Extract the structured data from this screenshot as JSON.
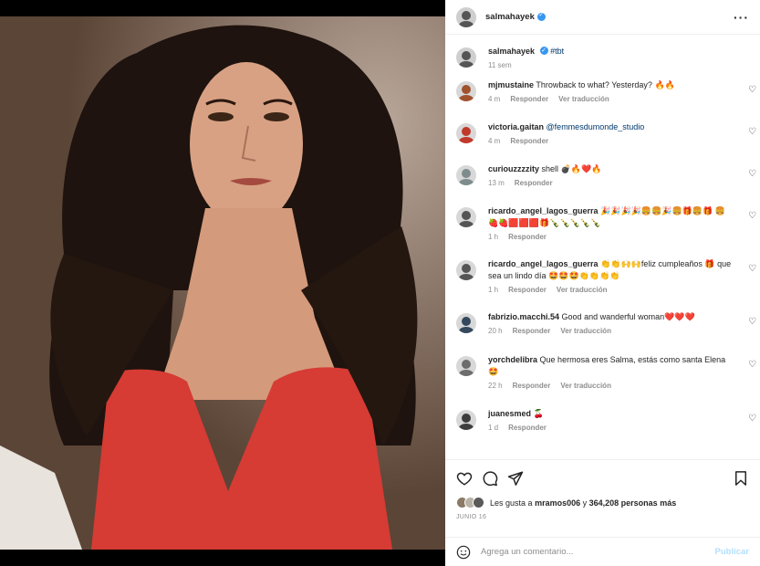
{
  "post": {
    "author": "salmahayek",
    "more_icon": "more-dots-icon",
    "image_description_label": ""
  },
  "caption": {
    "author": "salmahayek",
    "text": "#tbt",
    "time": "11 sem"
  },
  "labels": {
    "reply": "Responder",
    "translate": "Ver traducción"
  },
  "comments": [
    {
      "user": "mjmustaine",
      "text": "Throwback to what? Yesterday? 🔥🔥",
      "time": "4 m",
      "translate": true,
      "color": "#a0522d"
    },
    {
      "user": "victoria.gaitan",
      "text": "@femmesdumonde_studio",
      "mention": true,
      "time": "4 m",
      "translate": false,
      "color": "#c0392b"
    },
    {
      "user": "curiouzzzzity",
      "text": "shell 💣🔥❤️🔥",
      "time": "13 m",
      "translate": false,
      "color": "#7f8c8d"
    },
    {
      "user": "ricardo_angel_lagos_guerra",
      "text": "🎉🎉🎉🎉🍔🍔🎉🍔🎁🍔🎁 🍔🍓🍓🟥🟥🟥🎁🍾🍾🍾🍾🍾",
      "time": "1 h",
      "translate": false,
      "color": "#555555"
    },
    {
      "user": "ricardo_angel_lagos_guerra",
      "text": "👏👏🙌🙌feliz cumpleaños 🎁 que sea un lindo día 🤩🤩🤩👏👏👏👏",
      "time": "1 h",
      "translate": true,
      "color": "#555555"
    },
    {
      "user": "fabrizio.macchi.54",
      "text": "Good and wanderful woman❤️❤️❤️",
      "time": "20 h",
      "translate": true,
      "color": "#34495e"
    },
    {
      "user": "yorchdelibra",
      "text": "Que hermosa eres Salma, estás como santa Elena 🤩",
      "time": "22 h",
      "translate": true,
      "color": "#6d6d6d"
    },
    {
      "user": "juanesmed",
      "text": "🍒",
      "time": "1 d",
      "translate": false,
      "color": "#3d3d3d"
    }
  ],
  "likes": {
    "prefix": "Les gusta a",
    "user": "mramos006",
    "joiner": "y",
    "count": "364,208 personas más"
  },
  "date": "JUNIO 16",
  "add_comment": {
    "placeholder": "Agrega un comentario...",
    "publish": "Publicar"
  },
  "colors": {
    "accent": "#3897f0",
    "publish_disabled": "#b2dffc",
    "dress": "#d63b34"
  }
}
